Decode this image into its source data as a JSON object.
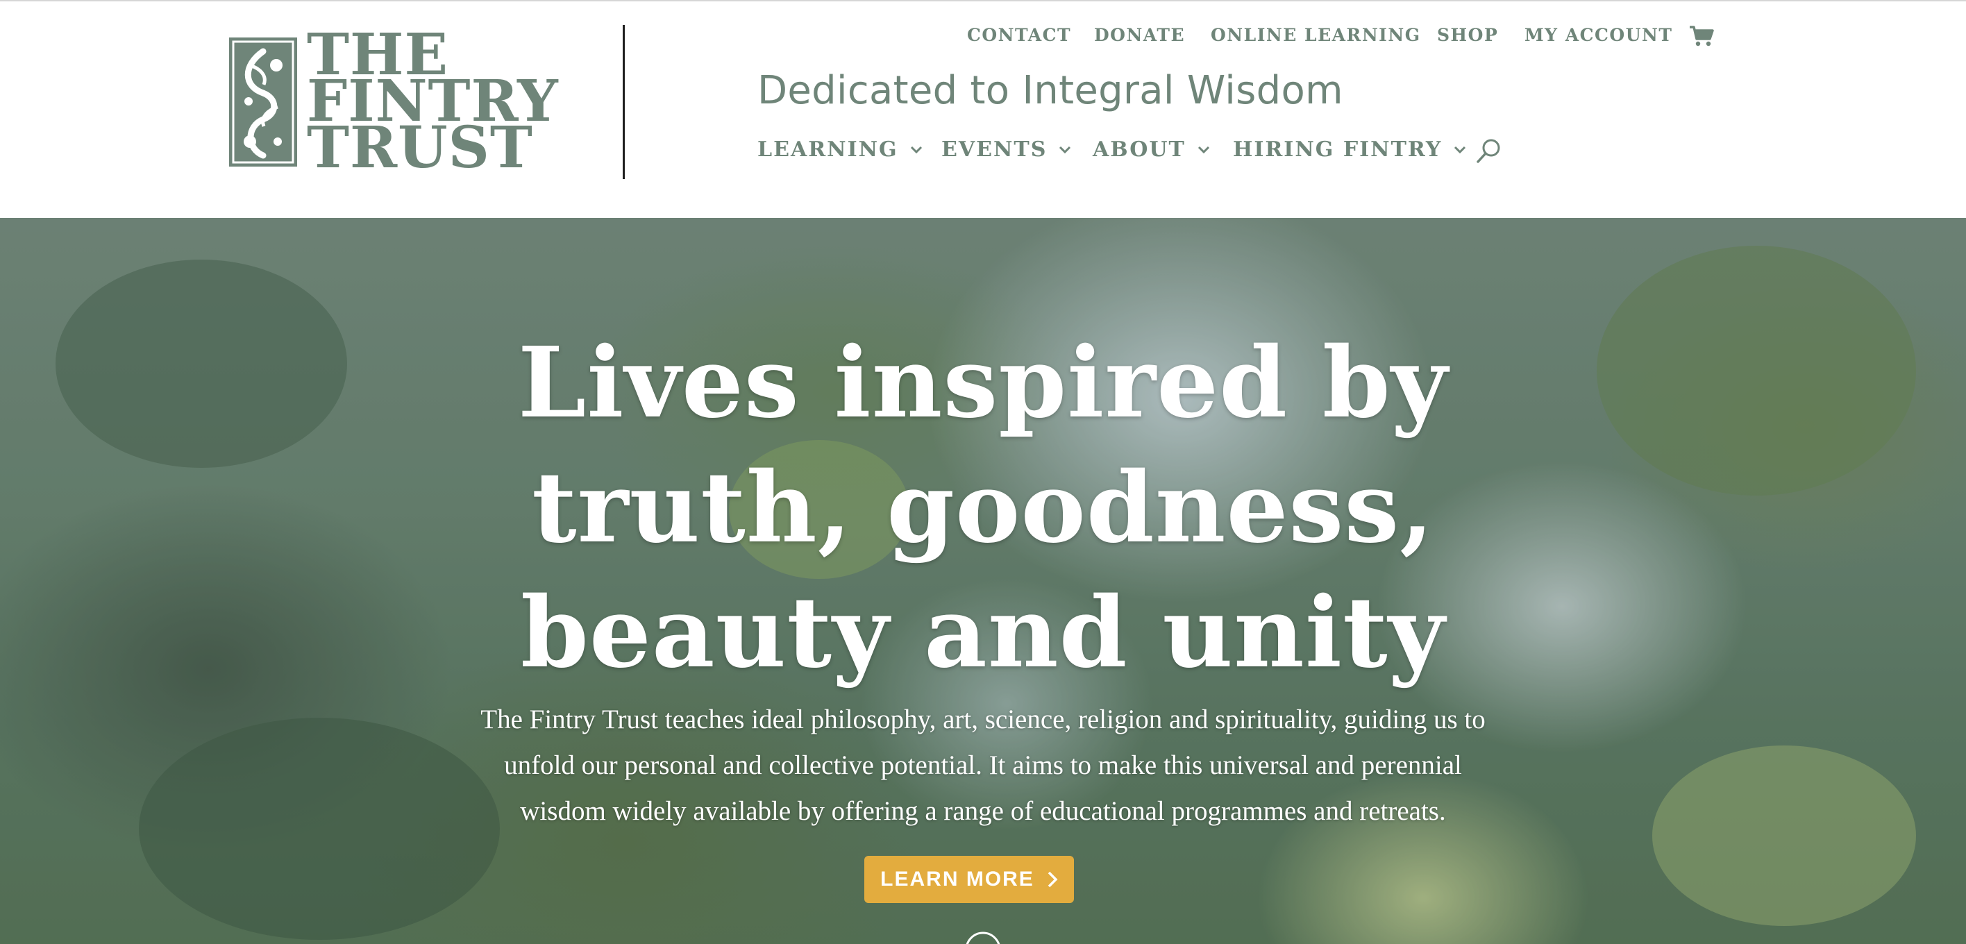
{
  "brand": {
    "logo_line1": "The",
    "logo_line2": "Fintry",
    "logo_line3": "Trust",
    "logo_color": "#6f8579"
  },
  "top_nav": {
    "items": [
      "CONTACT",
      "DONATE",
      "ONLINE LEARNING",
      "SHOP",
      "MY ACCOUNT"
    ],
    "cart_icon": "cart-icon"
  },
  "tagline": "Dedicated to Integral Wisdom",
  "main_nav": {
    "items": [
      {
        "label": "LEARNING",
        "icon": "chevron-down-icon"
      },
      {
        "label": "EVENTS",
        "icon": "chevron-down-icon"
      },
      {
        "label": "ABOUT",
        "icon": "chevron-down-icon"
      },
      {
        "label": "HIRING FINTRY",
        "icon": "chevron-down-icon"
      }
    ],
    "search_icon": "search-icon"
  },
  "hero": {
    "title_lines": [
      "Lives inspired by",
      "truth, goodness,",
      "beauty and unity"
    ],
    "description_lines": [
      "The Fintry Trust teaches ideal philosophy, art, science, religion and spirituality, guiding us to",
      "unfold our personal and collective potential. It aims to make this universal and perennial",
      "wisdom widely available by offering a range of educational programmes and retreats."
    ],
    "button_label": "LEARN MORE",
    "button_color": "#e3ac3e"
  },
  "colors": {
    "accent": "#6f8579",
    "button": "#e3ac3e",
    "text_on_hero": "#ffffff"
  }
}
